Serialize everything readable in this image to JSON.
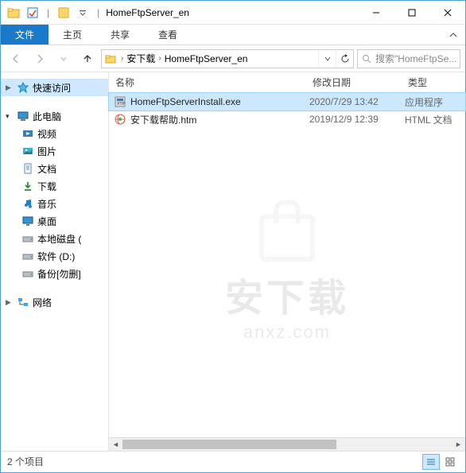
{
  "titlebar": {
    "title": "HomeFtpServer_en",
    "separator": "|"
  },
  "win_controls": {
    "min": "–",
    "max": "☐",
    "close": "✕"
  },
  "ribbon": {
    "file": "文件",
    "tabs": [
      "主页",
      "共享",
      "查看"
    ]
  },
  "address": {
    "crumbs": [
      "安下载",
      "HomeFtpServer_en"
    ]
  },
  "search": {
    "placeholder": "搜索\"HomeFtpSe..."
  },
  "nav": {
    "quick_access": "快速访问",
    "this_pc": "此电脑",
    "items": [
      {
        "label": "视频",
        "icon": "video"
      },
      {
        "label": "图片",
        "icon": "pictures"
      },
      {
        "label": "文档",
        "icon": "documents"
      },
      {
        "label": "下载",
        "icon": "downloads"
      },
      {
        "label": "音乐",
        "icon": "music"
      },
      {
        "label": "桌面",
        "icon": "desktop"
      },
      {
        "label": "本地磁盘 (",
        "icon": "drive"
      },
      {
        "label": "软件 (D:)",
        "icon": "drive"
      },
      {
        "label": "备份[勿删]",
        "icon": "drive"
      }
    ],
    "network": "网络"
  },
  "columns": {
    "name": "名称",
    "date": "修改日期",
    "type": "类型"
  },
  "files": [
    {
      "name": "HomeFtpServerInstall.exe",
      "date": "2020/7/29 13:42",
      "type": "应用程序",
      "icon": "exe",
      "selected": true
    },
    {
      "name": "安下载帮助.htm",
      "date": "2019/12/9 12:39",
      "type": "HTML 文档",
      "icon": "htm",
      "selected": false
    }
  ],
  "watermark": {
    "line1": "安下载",
    "line2": "anxz.com"
  },
  "status": {
    "text": "2 个项目"
  }
}
